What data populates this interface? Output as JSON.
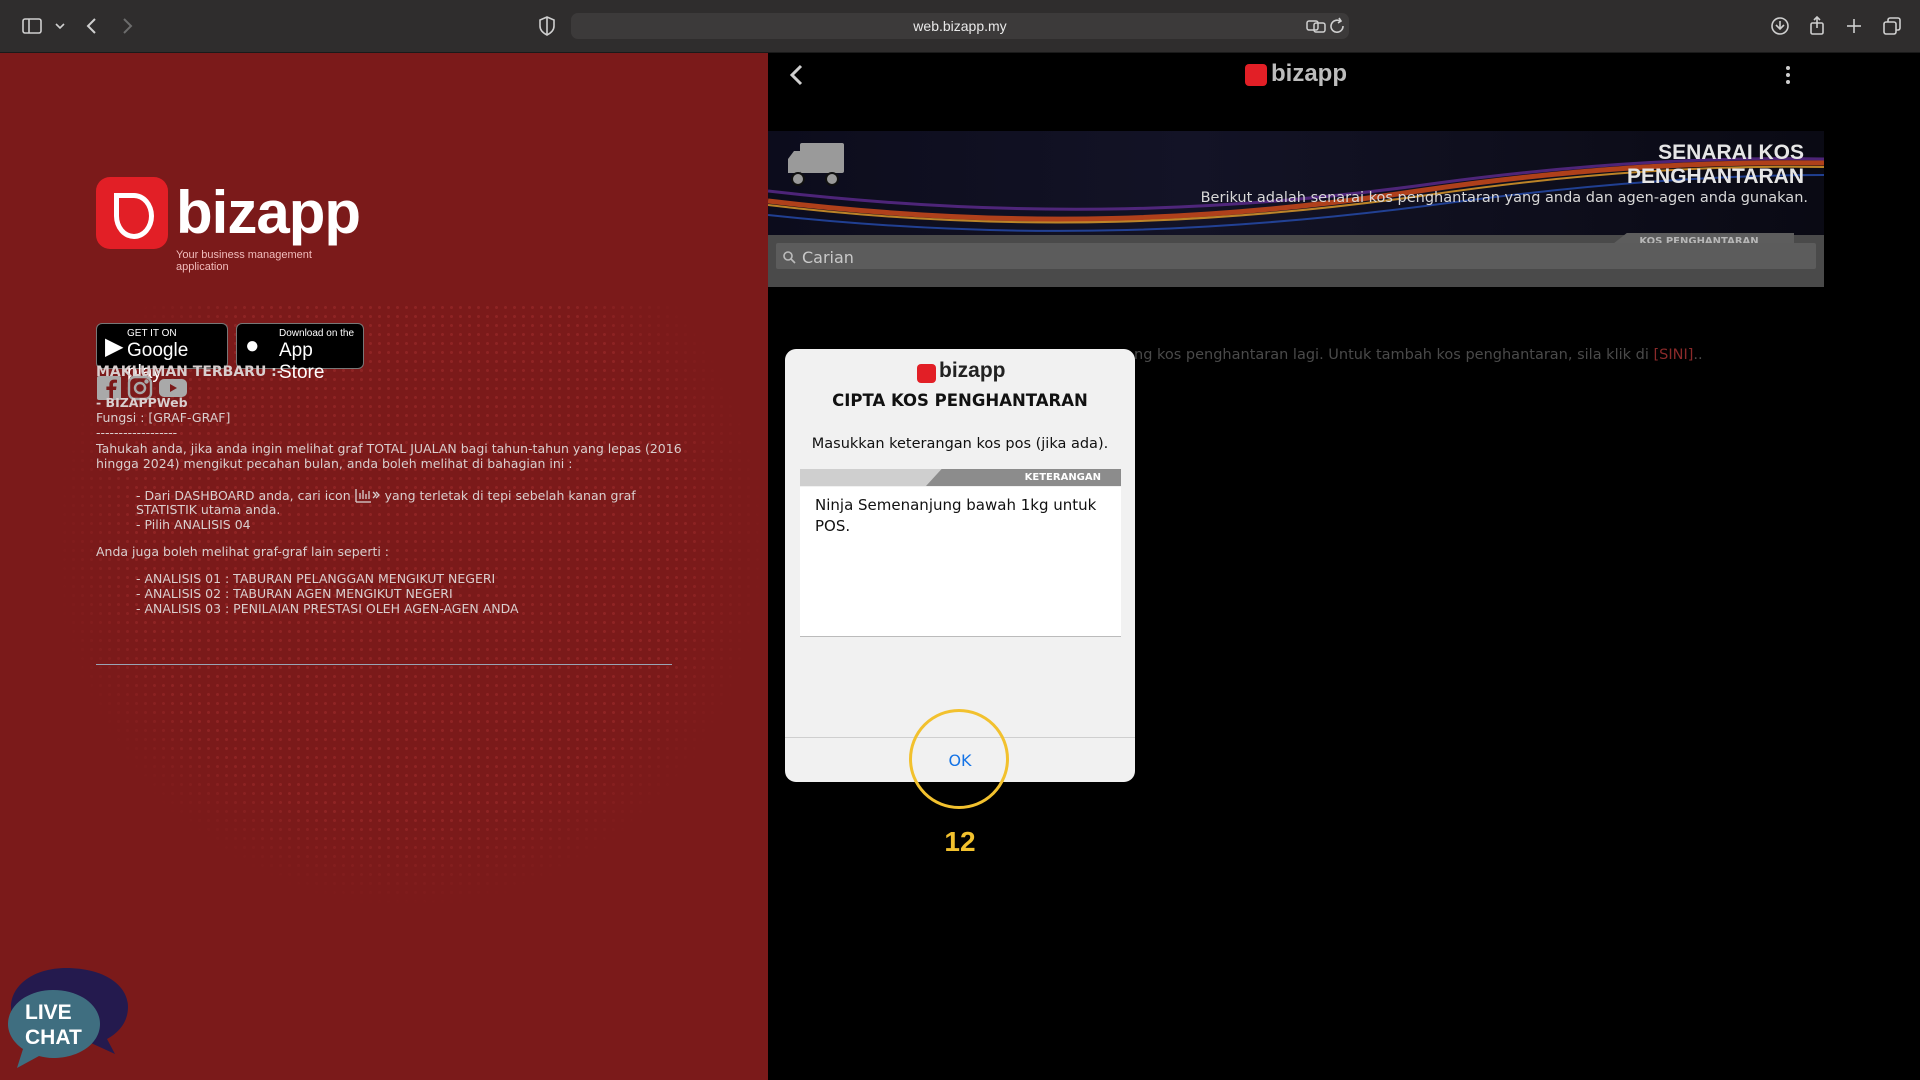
{
  "browser": {
    "url": "web.bizapp.my"
  },
  "left": {
    "brand": "bizapp",
    "tagline": "Your business management application",
    "google_badge": {
      "small": "GET IT ON",
      "large": "Google play"
    },
    "apple_badge": {
      "small": "Download on the",
      "large": "App Store"
    },
    "news_title": "MAKLUMAN TERBARU :-",
    "news_item_title": "- BIZAPPWeb",
    "news_function": "Fungsi : [GRAF-GRAF]",
    "news_divider": "------------------",
    "news_intro_1": "Tahukah anda, jika anda ingin melihat graf TOTAL JUALAN bagi tahun-tahun yang lepas (2016",
    "news_intro_2": "hingga 2024) mengikut pecahan bulan, anda boleh melihat di bahagian ini :",
    "step1_a": "- Dari DASHBOARD anda, cari icon",
    "step1_b": "yang terletak di tepi sebelah kanan graf",
    "step1_c": "STATISTIK utama anda.",
    "step2": "- Pilih ANALISIS 04",
    "others_intro": "Anda juga boleh melihat graf-graf lain seperti :",
    "others": [
      "- ANALISIS 01 : TABURAN PELANGGAN MENGIKUT NEGERI",
      "- ANALISIS 02 : TABURAN AGEN MENGIKUT NEGERI",
      "- ANALISIS 03 : PENILAIAN PRESTASI OLEH AGEN-AGEN ANDA"
    ],
    "livechat": {
      "line1": "LIVE",
      "line2": "CHAT"
    }
  },
  "right": {
    "brand": "bizapp",
    "banner_title_1": "SENARAI KOS",
    "banner_title_2": "PENGHANTARAN",
    "banner_sub": "Berikut adalah senarai kos penghantaran yang anda dan agen-agen anda gunakan.",
    "tab_label": "KOS PENGHANTARAN",
    "search_placeholder": "Carian",
    "empty_msg": "ng kos penghantaran lagi. Untuk tambah kos penghantaran, sila klik di ",
    "empty_link": "[SINI]",
    "empty_tail": ".."
  },
  "modal": {
    "brand": "bizapp",
    "title": "CIPTA KOS PENGHANTARAN",
    "description": "Masukkan keterangan kos pos (jika ada).",
    "field_label": "KETERANGAN",
    "field_value": "Ninja Semenanjung bawah 1kg untuk POS.",
    "ok_label": "OK"
  },
  "annotation": {
    "step": "12",
    "color": "#f2c12e"
  },
  "colors": {
    "brand_red": "#e21f26",
    "left_bg": "#7b1a1a",
    "link_blue": "#1473e6"
  }
}
